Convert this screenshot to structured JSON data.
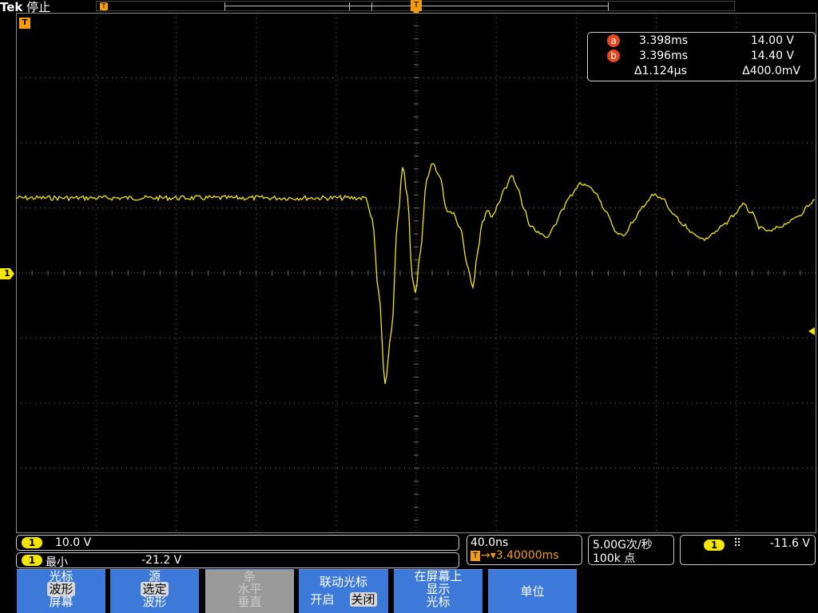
{
  "header": {
    "brand": "Tek",
    "run_state": "停止",
    "record_marker": "T",
    "trigger_marker": "T"
  },
  "graticule": {
    "trigger_time_marker": "T",
    "ch1_marker": "1",
    "trace_color": "#f4e600",
    "grid_color": "#6e6e6e"
  },
  "cursors": {
    "a": {
      "label": "a",
      "time": "3.398ms",
      "value": "14.00 V"
    },
    "b": {
      "label": "b",
      "time": "3.396ms",
      "value": "14.40 V"
    },
    "delta_time": "Δ1.124µs",
    "delta_value": "Δ400.0mV"
  },
  "readouts": {
    "ch1_scale": {
      "badge": "1",
      "value": "10.0 V"
    },
    "measurement": {
      "badge": "1",
      "name": "最小",
      "value": "-21.2 V"
    },
    "timebase": {
      "scale": "40.0ns",
      "trigger_marker": "T",
      "position": "→▾3.40000ms"
    },
    "acquisition": {
      "rate": "5.00G次/秒",
      "points": "100k 点"
    },
    "trigger": {
      "badge": "1",
      "slope_icon": "rising-edge-icon",
      "level": "-11.6 V"
    }
  },
  "menu": [
    {
      "lines": [
        "光标",
        "波形",
        "屏幕"
      ],
      "highlight": 1,
      "disabled": false
    },
    {
      "lines": [
        "源",
        "选定",
        "波形"
      ],
      "highlight": 1,
      "disabled": false
    },
    {
      "lines": [
        "条",
        "水平",
        "垂直"
      ],
      "highlight": -1,
      "disabled": true
    },
    {
      "title": "联动光标",
      "on": "开启",
      "off": "关闭",
      "disabled": false
    },
    {
      "lines": [
        "在屏幕上",
        "显示",
        "光标"
      ],
      "highlight": -1,
      "disabled": false
    },
    {
      "lines": [
        "单位"
      ],
      "highlight": -1,
      "disabled": false
    }
  ]
}
